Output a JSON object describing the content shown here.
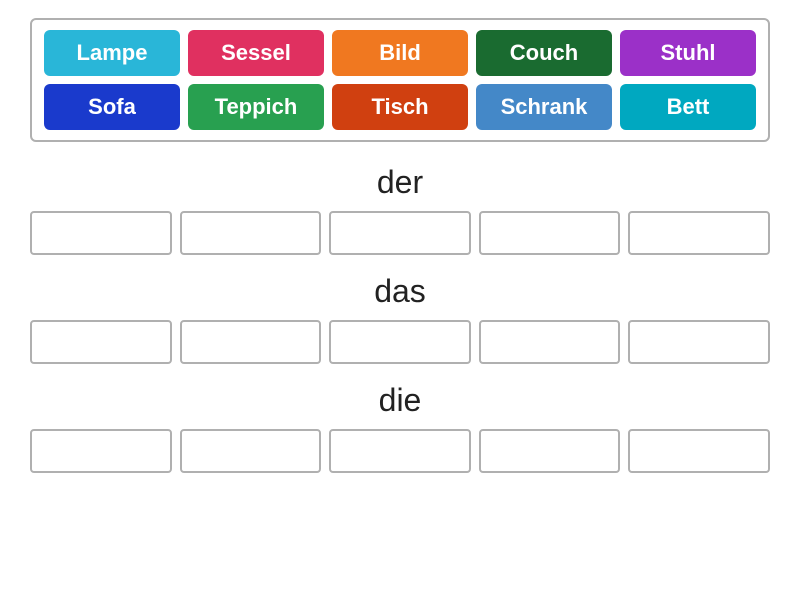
{
  "wordBank": {
    "tiles": [
      {
        "label": "Lampe",
        "color": "#29b6d8"
      },
      {
        "label": "Sessel",
        "color": "#e03060"
      },
      {
        "label": "Bild",
        "color": "#f07820"
      },
      {
        "label": "Couch",
        "color": "#1a6b30"
      },
      {
        "label": "Stuhl",
        "color": "#9b30c8"
      },
      {
        "label": "Sofa",
        "color": "#1a3acc"
      },
      {
        "label": "Teppich",
        "color": "#28a050"
      },
      {
        "label": "Tisch",
        "color": "#d04010"
      },
      {
        "label": "Schrank",
        "color": "#4488c8"
      },
      {
        "label": "Bett",
        "color": "#00a8c0"
      }
    ]
  },
  "sections": [
    {
      "label": "der",
      "id": "der"
    },
    {
      "label": "das",
      "id": "das"
    },
    {
      "label": "die",
      "id": "die"
    }
  ],
  "dropBoxCount": 5
}
